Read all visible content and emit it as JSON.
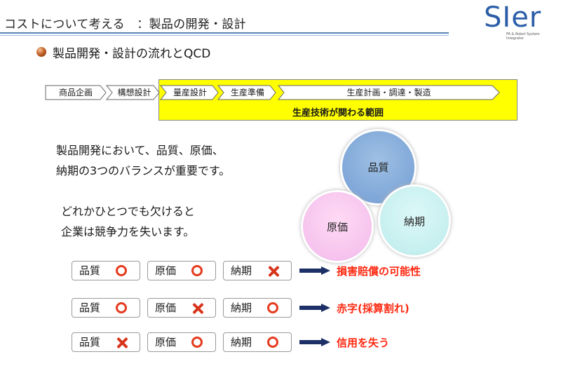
{
  "header": {
    "title": "コストについて考える　：製品の開発・設計",
    "logo_text": "SIer",
    "logo_subtext": "FA & Robot System Integrator"
  },
  "subtitle": "製品開発・設計の流れとQCD",
  "flow": {
    "steps": [
      "商品企画",
      "構想設計",
      "量産設計",
      "生産準備",
      "生産計画・調達・製造"
    ],
    "caption": "生産技術が関わる範囲",
    "highlight_color": "#ffff00"
  },
  "body": {
    "line1": "製品開発において、品質、原価、",
    "line2": "納期の3つのバランスが重要です。",
    "line3": "どれかひとつでも欠けると",
    "line4": "企業は競争力を失います。"
  },
  "circles": {
    "quality": "品質",
    "cost": "原価",
    "delivery": "納期"
  },
  "scenarios": [
    {
      "quality": "品質",
      "quality_mark": "circle",
      "cost": "原価",
      "cost_mark": "circle",
      "delivery": "納期",
      "delivery_mark": "cross",
      "result": "損害賠償の可能性"
    },
    {
      "quality": "品質",
      "quality_mark": "circle",
      "cost": "原価",
      "cost_mark": "cross",
      "delivery": "納期",
      "delivery_mark": "circle",
      "result": "赤字(採算割れ)"
    },
    {
      "quality": "品質",
      "quality_mark": "cross",
      "cost": "原価",
      "cost_mark": "circle",
      "delivery": "納期",
      "delivery_mark": "circle",
      "result": "信用を失う"
    }
  ],
  "colors": {
    "accent_blue": "#2c5ea8",
    "result_red": "#ff2a12",
    "mark_red": "#e53b1f"
  }
}
